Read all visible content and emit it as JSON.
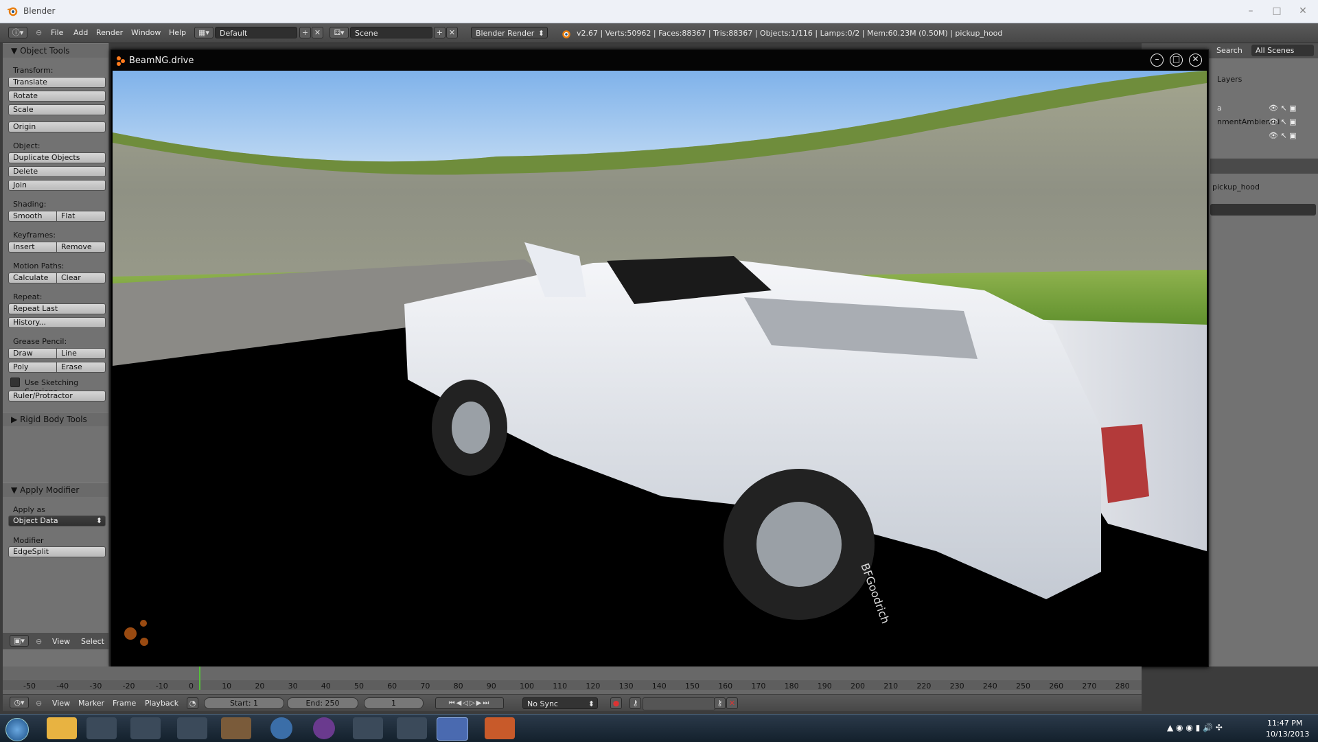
{
  "os": {
    "window_title": "Blender",
    "controls": [
      "–",
      "□",
      "✕"
    ]
  },
  "header": {
    "menus": [
      "File",
      "Add",
      "Render",
      "Window",
      "Help"
    ],
    "layout": "Default",
    "scene": "Scene",
    "engine": "Blender Render",
    "stats": "v2.67 | Verts:50962 | Faces:88367 | Tris:88367 | Objects:1/116 | Lamps:0/2 | Mem:60.23M (0.50M) | pickup_hood"
  },
  "tools": {
    "panel_title": "Object Tools",
    "transform_label": "Transform:",
    "translate": "Translate",
    "rotate": "Rotate",
    "scale": "Scale",
    "origin": "Origin",
    "object_label": "Object:",
    "duplicate": "Duplicate Objects",
    "delete": "Delete",
    "join": "Join",
    "shading_label": "Shading:",
    "smooth": "Smooth",
    "flat": "Flat",
    "keyframes_label": "Keyframes:",
    "insert": "Insert",
    "remove": "Remove",
    "motion_label": "Motion Paths:",
    "calculate": "Calculate",
    "clear": "Clear",
    "repeat_label": "Repeat:",
    "repeat_last": "Repeat Last",
    "history": "History...",
    "grease_label": "Grease Pencil:",
    "draw": "Draw",
    "line": "Line",
    "poly": "Poly",
    "erase": "Erase",
    "sketching": "Use Sketching Sessions",
    "ruler": "Ruler/Protractor",
    "rigid_title": "Rigid Body Tools",
    "apply_title": "Apply Modifier",
    "apply_as_label": "Apply as",
    "apply_as_value": "Object Data",
    "modifier_label": "Modifier",
    "modifier_value": "EdgeSplit"
  },
  "viewport_header": {
    "view": "View",
    "select": "Select"
  },
  "right": {
    "search": "Search",
    "scenes": "All Scenes",
    "layers": "Layers",
    "row1": "a",
    "row2": "nmentAmbientLi",
    "object_name": "pickup_hood"
  },
  "game": {
    "title": "BeamNG.drive",
    "min": "–",
    "max": "□",
    "close": "✕",
    "tire_brand": "BFGoodrich"
  },
  "timeline": {
    "ticks": [
      "-50",
      "-40",
      "-30",
      "-20",
      "-10",
      "0",
      "10",
      "20",
      "30",
      "40",
      "50",
      "60",
      "70",
      "80",
      "90",
      "100",
      "110",
      "120",
      "130",
      "140",
      "150",
      "160",
      "170",
      "180",
      "190",
      "200",
      "210",
      "220",
      "230",
      "240",
      "250",
      "260",
      "270",
      "280"
    ],
    "view": "View",
    "marker": "Marker",
    "frame": "Frame",
    "playback": "Playback",
    "start": "Start: 1",
    "end": "End: 250",
    "current": "1",
    "sync": "No Sync"
  },
  "taskbar": {
    "time": "11:47 PM",
    "date": "10/13/2013"
  }
}
